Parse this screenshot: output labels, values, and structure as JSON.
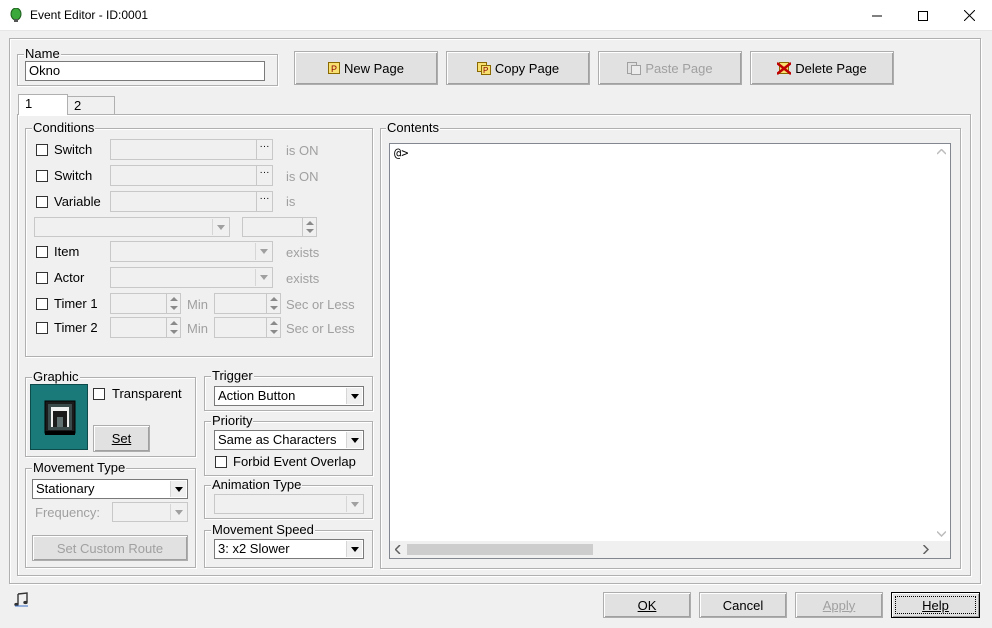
{
  "window": {
    "title": "Event Editor - ID:0001",
    "controls": {
      "minimize": "minimize-icon",
      "maximize": "maximize-icon",
      "close": "close-icon"
    }
  },
  "name": {
    "label": "Name",
    "value": "Okno"
  },
  "toolbar": {
    "new_page": "New Page",
    "copy_page": "Copy Page",
    "paste_page": "Paste Page",
    "delete_page": "Delete Page"
  },
  "tabs": [
    "1",
    "2"
  ],
  "conditions": {
    "label": "Conditions",
    "switch1": {
      "label": "Switch",
      "suffix": "is ON"
    },
    "switch2": {
      "label": "Switch",
      "suffix": "is ON"
    },
    "variable": {
      "label": "Variable",
      "suffix": "is"
    },
    "item": {
      "label": "Item",
      "suffix": "exists"
    },
    "actor": {
      "label": "Actor",
      "suffix": "exists"
    },
    "timer1": {
      "label": "Timer 1",
      "min": "Min",
      "sec": "Sec or Less"
    },
    "timer2": {
      "label": "Timer 2",
      "min": "Min",
      "sec": "Sec or Less"
    }
  },
  "graphic": {
    "label": "Graphic",
    "transparent": "Transparent",
    "set_button": "Set"
  },
  "trigger": {
    "label": "Trigger",
    "value": "Action Button"
  },
  "priority": {
    "label": "Priority",
    "value": "Same as Characters",
    "forbid_overlap": "Forbid Event Overlap"
  },
  "movement_type": {
    "label": "Movement Type",
    "value": "Stationary",
    "frequency_label": "Frequency:",
    "custom_route": "Set Custom Route"
  },
  "animation_type": {
    "label": "Animation Type"
  },
  "movement_speed": {
    "label": "Movement Speed",
    "value": "3: x2 Slower"
  },
  "contents": {
    "label": "Contents",
    "lines": [
      "@>"
    ]
  },
  "footer": {
    "ok": "OK",
    "cancel": "Cancel",
    "apply": "Apply",
    "help": "Help",
    "sound_icon": "music-note-icon"
  },
  "colors": {
    "graphic_bg": "#1a7a7a",
    "delete_icon": "#c00000"
  }
}
